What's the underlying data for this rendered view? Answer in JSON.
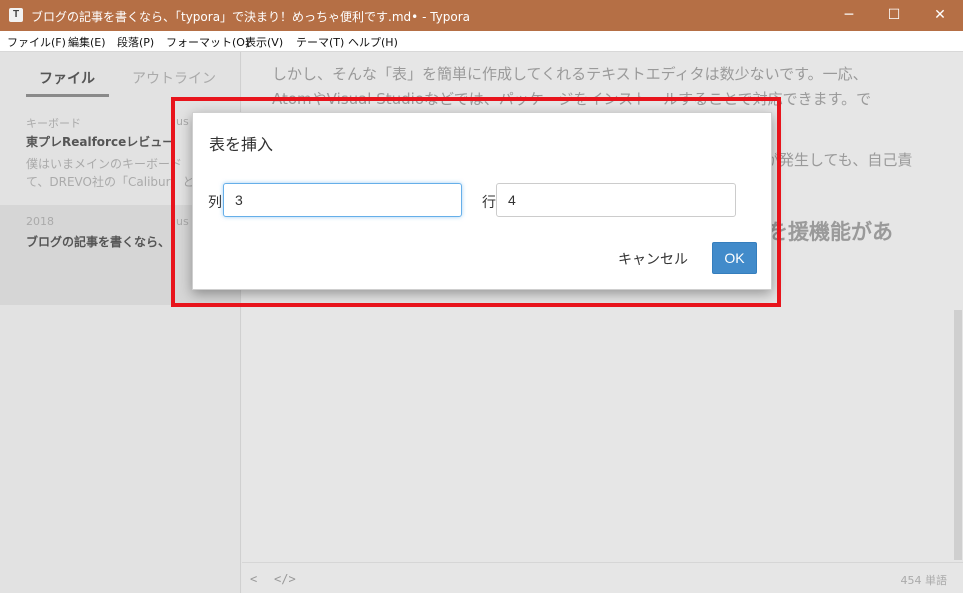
{
  "window": {
    "title": "ブログの記事を書くなら、「typora」で決まり！めっちゃ便利です.md• - Typora",
    "app_icon_letter": "T",
    "controls": {
      "minimize": "─",
      "maximize": "☐",
      "close": "✕"
    }
  },
  "menu": {
    "items": [
      "ファイル(F)",
      "編集(E)",
      "段落(P)",
      "フォーマット(O)",
      "表示(V)",
      "テーマ(T)",
      "ヘルプ(H)"
    ]
  },
  "sidebar": {
    "tabs": {
      "files": "ファイル",
      "outline": "アウトライン"
    },
    "docs": [
      {
        "date": "キーボード",
        "author": "us",
        "title": "東プレRealforceレビュー",
        "excerpt_1": "僕はいまメインのキーボード",
        "excerpt_2": "て、DREVO社の「Calibur」と"
      },
      {
        "date": "2018",
        "author": "us",
        "title": "ブログの記事を書くなら、"
      }
    ]
  },
  "editor": {
    "line_1": "しかし、そんな「表」を簡単に作成してくれるテキストエディタは数少ないです。一応、",
    "line_2": "AtomやVisual Studioなどでは、パッケージをインストールすることで対応できます。で",
    "line_3": "が発生しても、自己責",
    "heading_fragment": "を援機能があ"
  },
  "footer": {
    "back_icon": "<",
    "source_icon": "</>",
    "word_count": "454 単語"
  },
  "dialog": {
    "title": "表を挿入",
    "columns_label": "列",
    "columns_value": "3",
    "rows_label": "行",
    "rows_value": "4",
    "cancel_label": "キャンセル",
    "ok_label": "OK"
  },
  "colors": {
    "titlebar": "#b56f45",
    "accent": "#428bca",
    "highlight": "#e8141c"
  }
}
